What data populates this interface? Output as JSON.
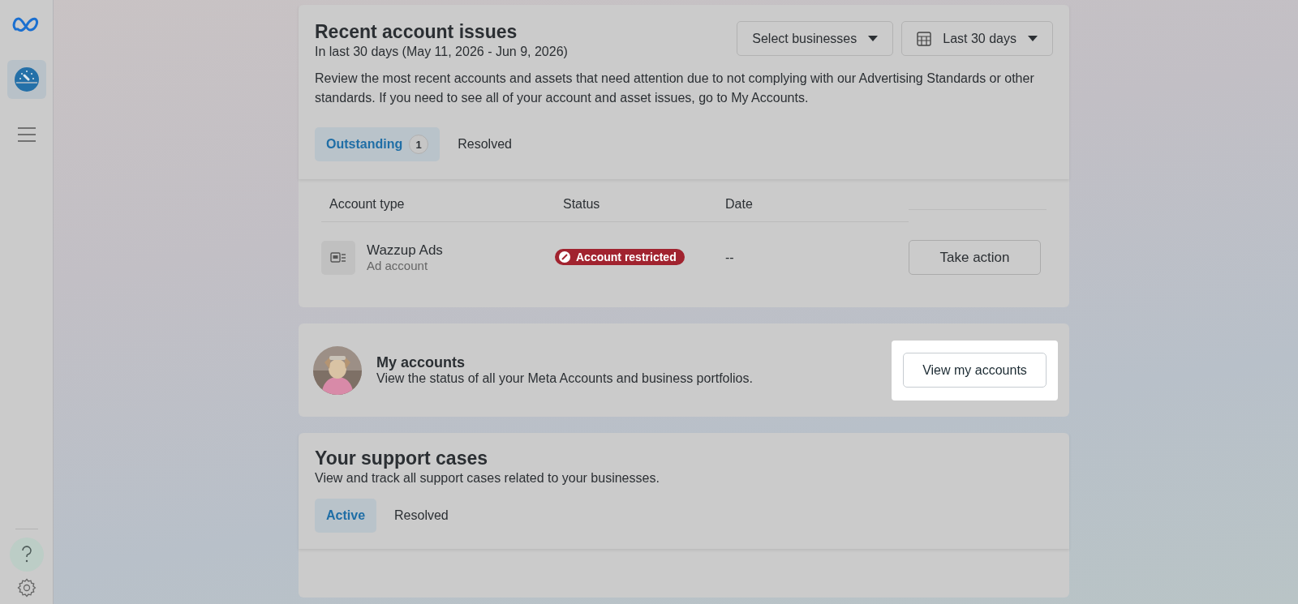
{
  "sidebar": {
    "items": [
      {
        "kind": "dashboard",
        "selected": true
      },
      {
        "kind": "menu",
        "selected": false
      }
    ]
  },
  "issues": {
    "title": "Recent account issues",
    "subtitle": "In last 30 days (May 11, 2026 - Jun 9, 2026)",
    "description": "Review the most recent accounts and assets that need attention due to not complying with our Advertising Standards or other standards. If you need to see all of your account and asset issues, go to My Accounts.",
    "filters": [
      {
        "kind": "dropdown",
        "label": "Select businesses"
      },
      {
        "kind": "date",
        "label": "Last 30 days"
      }
    ],
    "tabs": [
      {
        "label": "Outstanding",
        "count": "1",
        "selected": true
      },
      {
        "label": "Resolved",
        "selected": false
      }
    ],
    "table": {
      "columns": [
        "Account type",
        "Status",
        "Date"
      ],
      "rows": [
        {
          "name": "Wazzup Ads",
          "type": "Ad account",
          "status": "Account restricted",
          "date": "--",
          "action": "Take action"
        }
      ]
    }
  },
  "my_accounts": {
    "title": "My accounts",
    "description": "View the status of all your Meta Accounts and business portfolios.",
    "button": "View my accounts",
    "highlighted": true
  },
  "support": {
    "title": "Your support cases",
    "description": "View and track all support cases related to your businesses.",
    "tabs": [
      {
        "label": "Active",
        "selected": true
      },
      {
        "label": "Resolved",
        "selected": false
      }
    ]
  }
}
